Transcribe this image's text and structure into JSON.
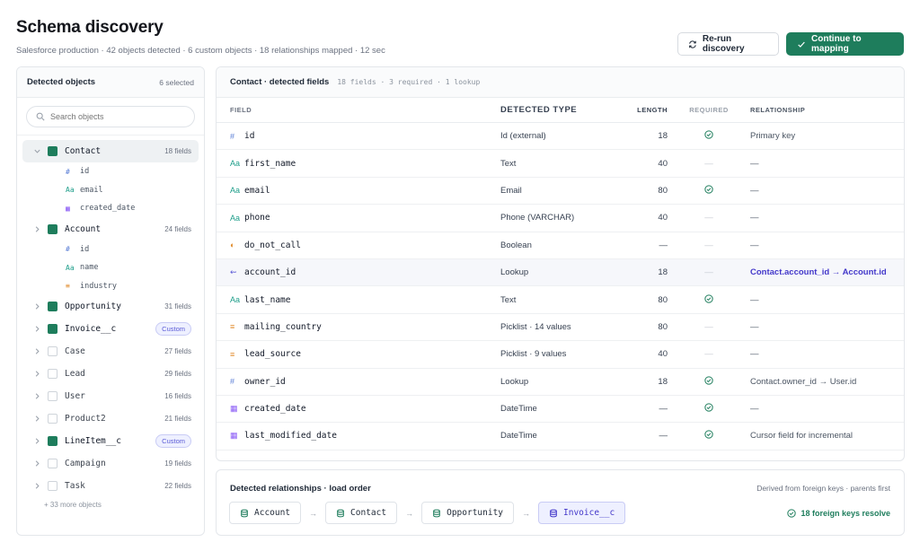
{
  "header": {
    "title": "Schema discovery",
    "subtitle": "Salesforce production · 42 objects detected · 6 custom objects · 18 relationships mapped · 12 sec",
    "rerun_label": "Re-run discovery",
    "continue_label": "Continue to mapping"
  },
  "sidebar": {
    "title": "Detected objects",
    "selected_count": "6 selected",
    "search_placeholder": "Search objects",
    "objects": [
      {
        "name": "Contact",
        "count": "18 fields"
      },
      {
        "name": "Account",
        "count": "24 fields"
      },
      {
        "name": "Opportunity",
        "count": "31 fields"
      },
      {
        "name": "Invoice__c",
        "count": "Custom"
      },
      {
        "name": "Case",
        "count": "27 fields"
      },
      {
        "name": "Lead",
        "count": "29 fields"
      },
      {
        "name": "User",
        "count": "16 fields"
      },
      {
        "name": "Product2",
        "count": "21 fields"
      },
      {
        "name": "LineItem__c",
        "count": "Custom"
      },
      {
        "name": "Campaign",
        "count": "19 fields"
      },
      {
        "name": "Task",
        "count": "22 fields"
      }
    ],
    "contact_children": [
      "id",
      "email",
      "created_date"
    ],
    "account_children": [
      "id",
      "name",
      "industry"
    ],
    "more": "+ 33 more objects"
  },
  "table": {
    "title": "Contact · detected fields",
    "meta": "18 fields · 3 required · 1 lookup",
    "columns": [
      "FIELD",
      "DETECTED TYPE",
      "LENGTH",
      "REQUIRED",
      "RELATIONSHIP"
    ],
    "rows": [
      {
        "icon": "#",
        "name": "id",
        "type": "Id (external)",
        "length": "18",
        "rel": "Primary key"
      },
      {
        "icon": "Aa",
        "name": "first_name",
        "type": "Text",
        "length": "40",
        "rel": "—"
      },
      {
        "icon": "Aa",
        "name": "email",
        "type": "Email",
        "length": "80",
        "rel": "—"
      },
      {
        "icon": "Aa",
        "name": "phone",
        "type": "Phone (VARCHAR)",
        "length": "40",
        "rel": "—"
      },
      {
        "icon": "◐",
        "name": "do_not_call",
        "type": "Boolean",
        "length": "—",
        "rel": "—"
      },
      {
        "icon": "⇜",
        "name": "account_id",
        "type": "Lookup",
        "length": "18",
        "rel": "Contact.account_id → Account.id"
      },
      {
        "icon": "Aa",
        "name": "last_name",
        "type": "Text",
        "length": "80",
        "rel": "—"
      },
      {
        "icon": "≡",
        "name": "mailing_country",
        "type": "Picklist · 14 values",
        "length": "80",
        "rel": "—"
      },
      {
        "icon": "≡",
        "name": "lead_source",
        "type": "Picklist · 9 values",
        "length": "40",
        "rel": "—"
      },
      {
        "icon": "#",
        "name": "owner_id",
        "type": "Lookup",
        "length": "18",
        "rel": "Contact.owner_id → User.id"
      },
      {
        "icon": "▦",
        "name": "created_date",
        "type": "DateTime",
        "length": "—",
        "rel": "—"
      },
      {
        "icon": "▦",
        "name": "last_modified_date",
        "type": "DateTime",
        "length": "—",
        "rel": "Cursor field for incremental"
      }
    ]
  },
  "relationships": {
    "title": "Detected relationships · load order",
    "note": "Derived from foreign keys · parents first",
    "chain": [
      "Account",
      "Contact",
      "Opportunity",
      "Invoice__c"
    ],
    "resolve": "18 foreign keys resolve"
  },
  "colors": {
    "accent": "#1e7d5c",
    "link": "#4338ca"
  }
}
